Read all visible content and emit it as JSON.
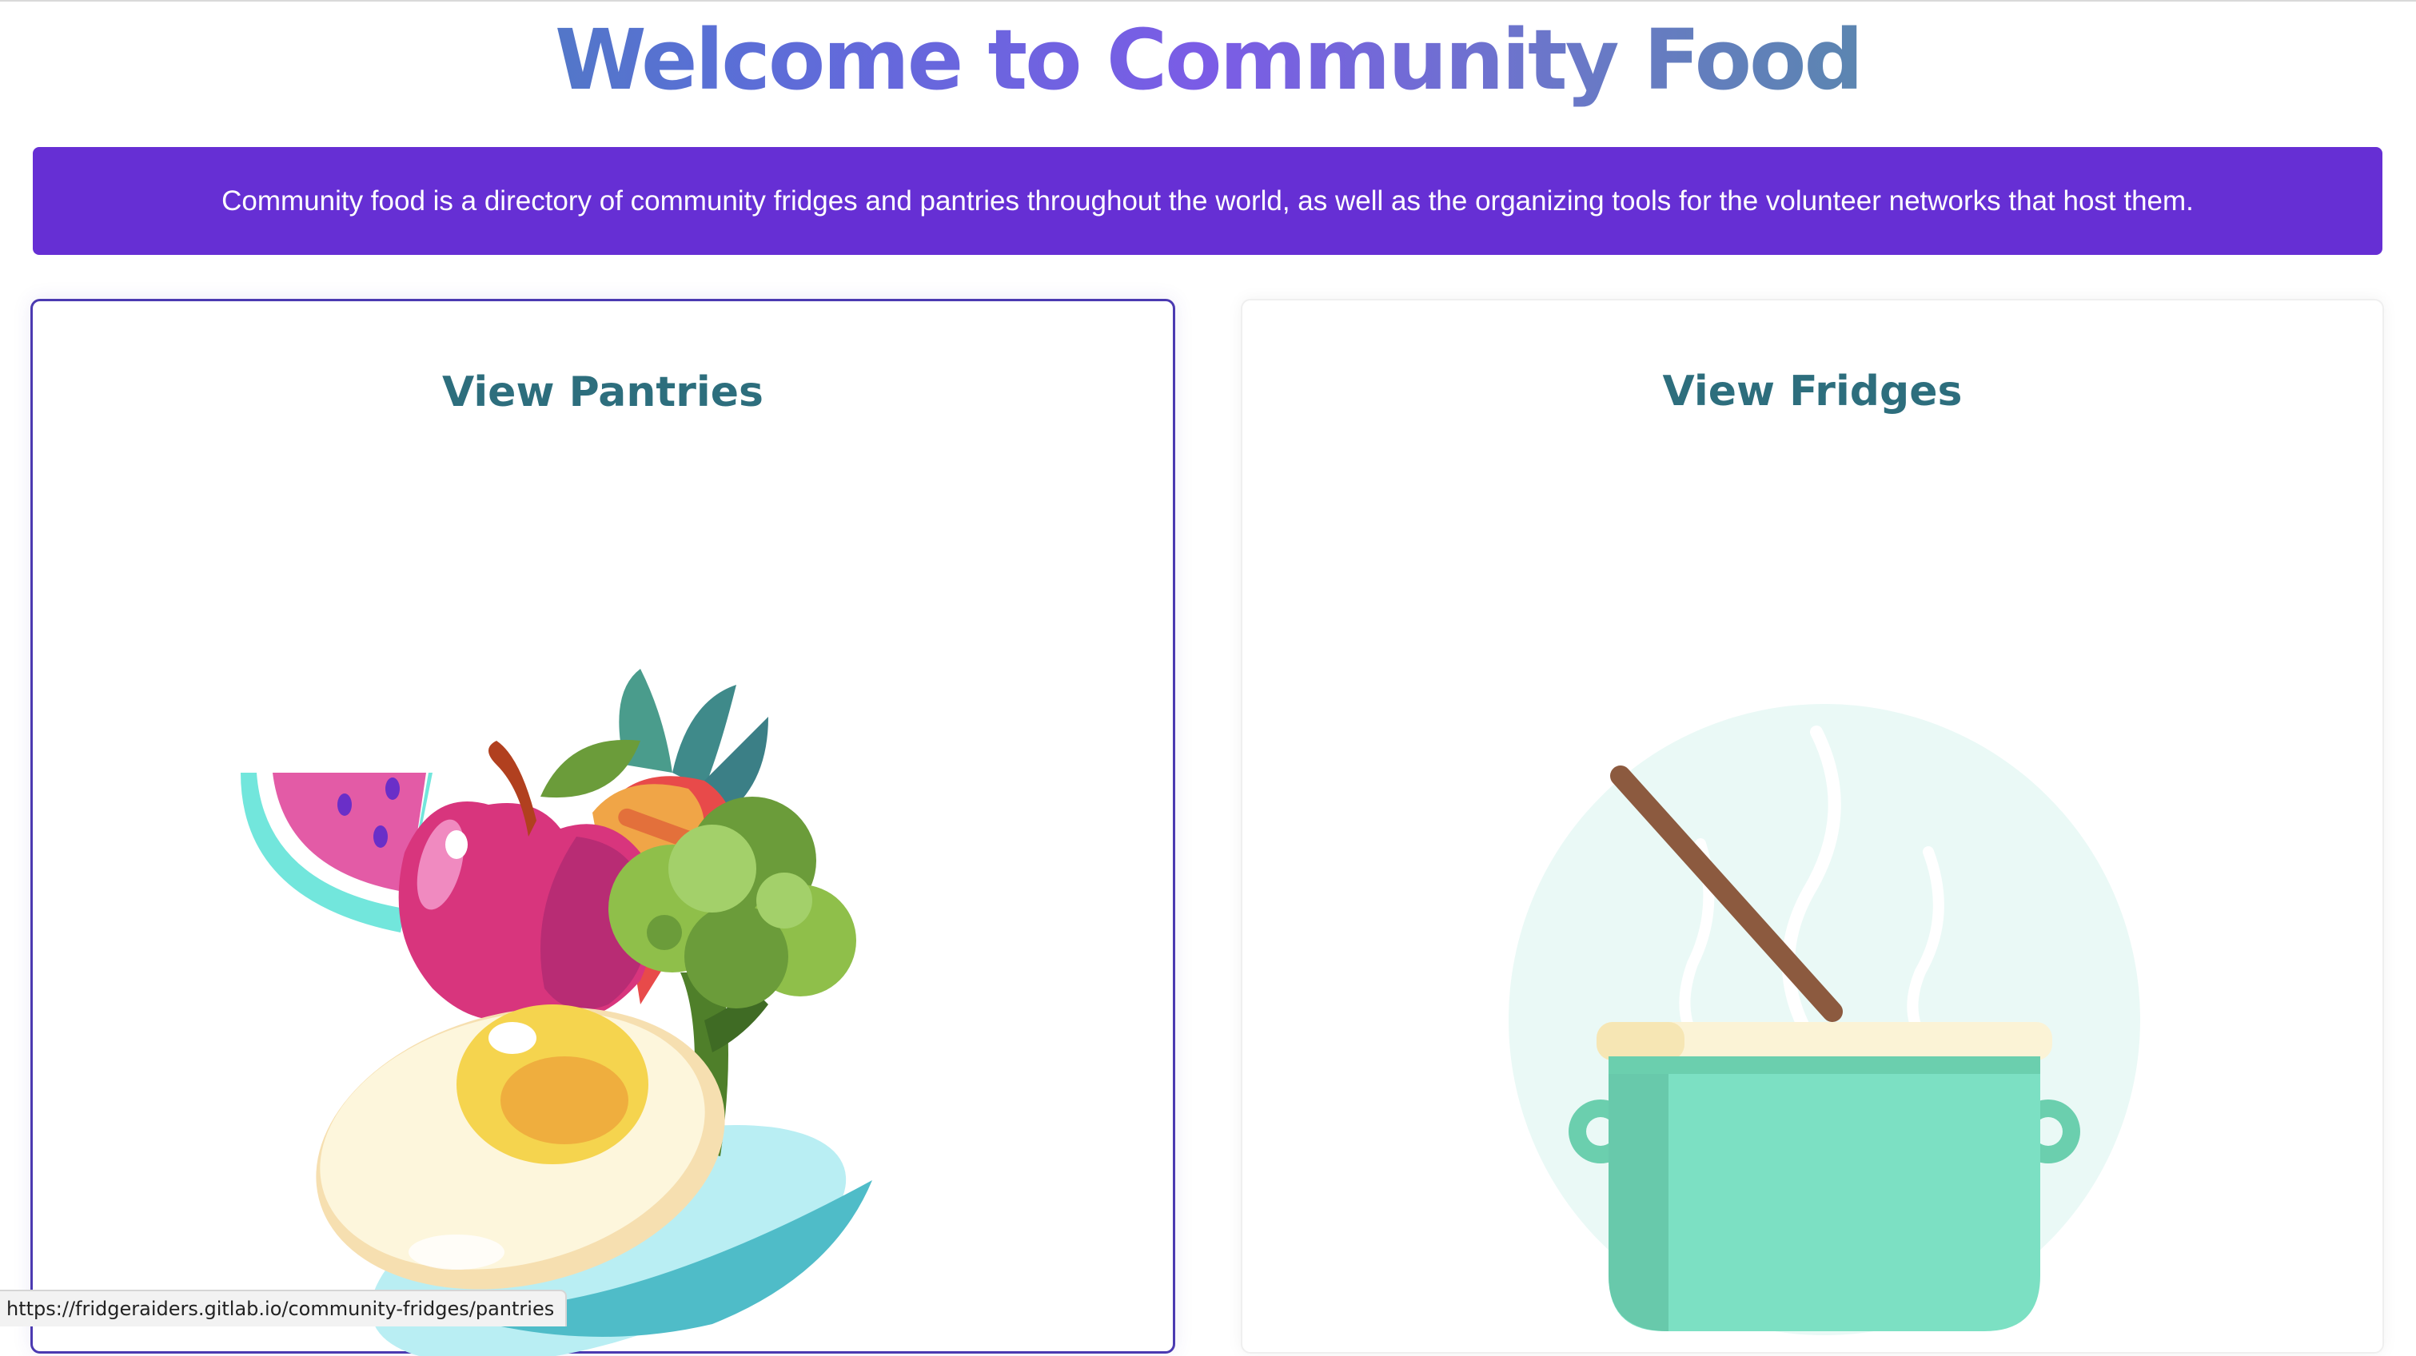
{
  "page": {
    "title": "Welcome to Community Food",
    "description": "Community food is a directory of community fridges and pantries throughout the world, as well as the organizing tools for the volunteer networks that host them."
  },
  "cards": [
    {
      "title": "View Pantries",
      "icon": "fruit-vegetable-plate-icon"
    },
    {
      "title": "View Fridges",
      "icon": "cooking-pot-icon"
    }
  ],
  "status_bar": {
    "url": "https://fridgeraiders.gitlab.io/community-fridges/pantries"
  },
  "colors": {
    "banner": "#662fd4",
    "card_title": "#2d6e7d",
    "selected_border": "#4b3ab1"
  }
}
